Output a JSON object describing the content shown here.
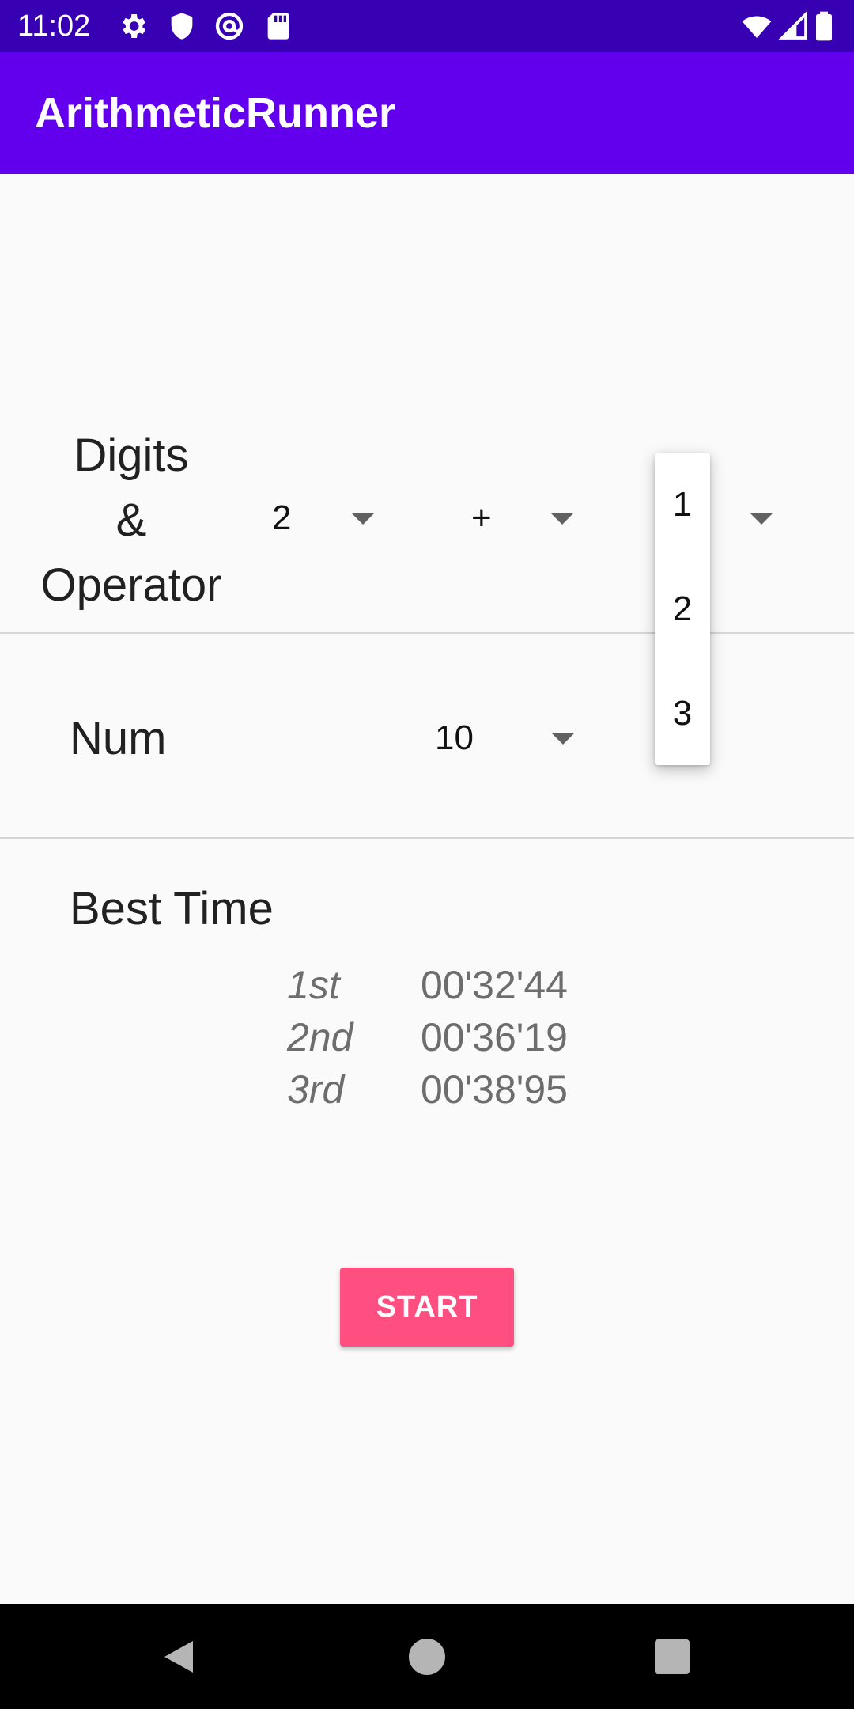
{
  "status_bar": {
    "time": "11:02",
    "left_icons": [
      "gear-icon",
      "shield-icon",
      "at-sign-icon",
      "sd-card-icon"
    ],
    "right_icons": [
      "wifi-icon",
      "signal-icon",
      "battery-icon"
    ]
  },
  "app_bar": {
    "title": "ArithmeticRunner",
    "color": "#6200ee"
  },
  "digits_row": {
    "label": "Digits\n&\nOperator",
    "digits_value": "2",
    "operator_value": "+",
    "third_value": ""
  },
  "num_row": {
    "label": "Num",
    "value": "10"
  },
  "best_time": {
    "label": "Best Time",
    "entries": [
      {
        "rank": "1st",
        "time": "00'32'44"
      },
      {
        "rank": "2nd",
        "time": "00'36'19"
      },
      {
        "rank": "3rd",
        "time": "00'38'95"
      }
    ]
  },
  "start_button": {
    "label": "START",
    "color": "#ff4f81"
  },
  "dropdown": {
    "options": [
      "1",
      "2",
      "3"
    ]
  },
  "nav_bar": {
    "buttons": [
      "back-icon",
      "home-icon",
      "recents-icon"
    ]
  }
}
